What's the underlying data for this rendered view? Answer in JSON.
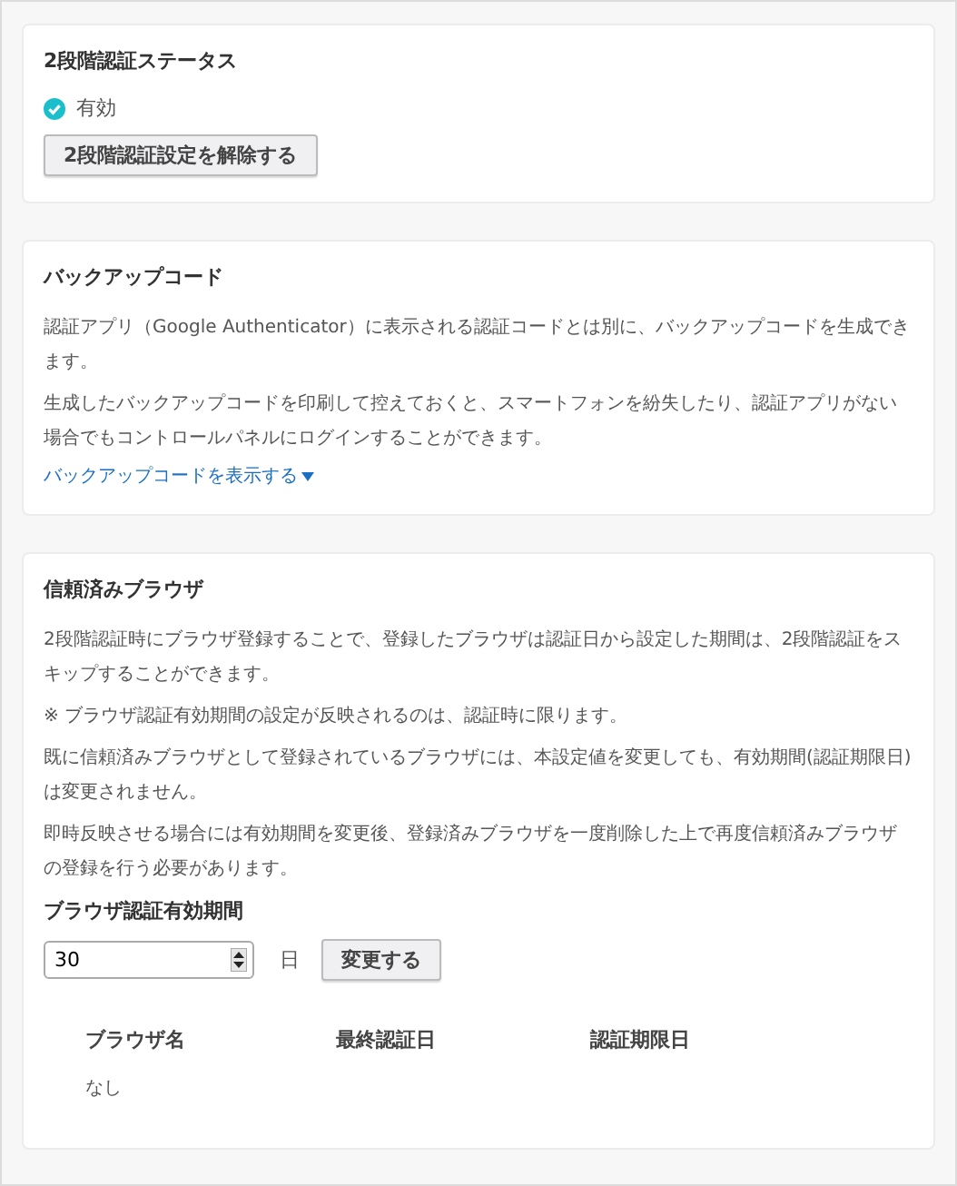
{
  "status_card": {
    "title": "2段階認証ステータス",
    "enabled": true,
    "status_label": "有効",
    "button": "2段階認証設定を解除する"
  },
  "backup_card": {
    "title": "バックアップコード",
    "paragraphs": [
      "認証アプリ（Google Authenticator）に表示される認証コードとは別に、バックアップコードを生成できます。",
      "生成したバックアップコードを印刷して控えておくと、スマートフォンを紛失したり、認証アプリがない場合でもコントロールパネルにログインすることができます。"
    ],
    "link": "バックアップコードを表示する",
    "expanded": false
  },
  "trusted_card": {
    "title": "信頼済みブラウザ",
    "paragraphs": [
      "2段階認証時にブラウザ登録することで、登録したブラウザは認証日から設定した期間は、2段階認証をスキップすることができます。",
      "※ ブラウザ認証有効期間の設定が反映されるのは、認証時に限ります。",
      "既に信頼済みブラウザとして登録されているブラウザには、本設定値を変更しても、有効期間(認証期限日)は変更されません。",
      "即時反映させる場合には有効期間を変更後、登録済みブラウザを一度削除した上で再度信頼済みブラウザの登録を行う必要があります。"
    ],
    "period_label": "ブラウザ認証有効期間",
    "period_value": "30",
    "unit": "日",
    "button": "変更する",
    "table": {
      "columns": [
        "ブラウザ名",
        "最終認証日",
        "認証期限日"
      ],
      "empty_text": "なし"
    }
  }
}
